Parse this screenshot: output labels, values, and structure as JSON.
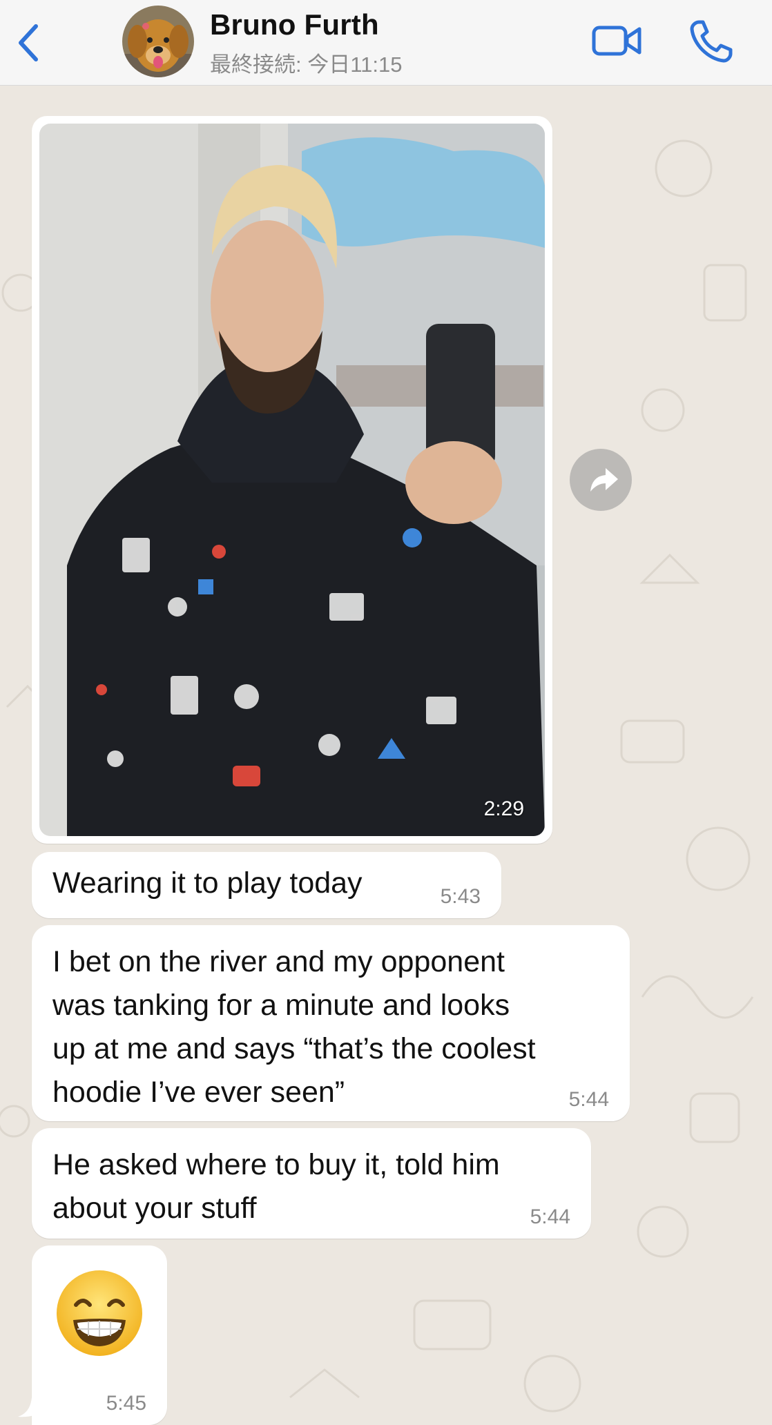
{
  "header": {
    "back_icon": "chevron-left-icon",
    "contact_name": "Bruno Furth",
    "last_seen": "最終接続: 今日11:15",
    "video_icon": "video-camera-icon",
    "call_icon": "phone-icon",
    "accent_color": "#2f73d8"
  },
  "messages": [
    {
      "type": "photo",
      "time": "2:29"
    },
    {
      "type": "text",
      "lines": [
        "Wearing it to play today"
      ],
      "time": "5:43"
    },
    {
      "type": "text",
      "lines": [
        "I bet on the river and my opponent",
        "was tanking for a minute and looks",
        "up at me and says “that’s the coolest",
        "hoodie I’ve ever seen”"
      ],
      "time": "5:44"
    },
    {
      "type": "text",
      "lines": [
        "He asked where to buy it, told him",
        "about your stuff"
      ],
      "time": "5:44"
    },
    {
      "type": "emoji",
      "emoji_icon": "grinning-face-icon",
      "time": "5:45"
    }
  ],
  "forward_icon": "share-forward-icon",
  "colors": {
    "chat_background": "#ece7e0",
    "bubble": "#ffffff",
    "header": "#f6f6f6"
  }
}
